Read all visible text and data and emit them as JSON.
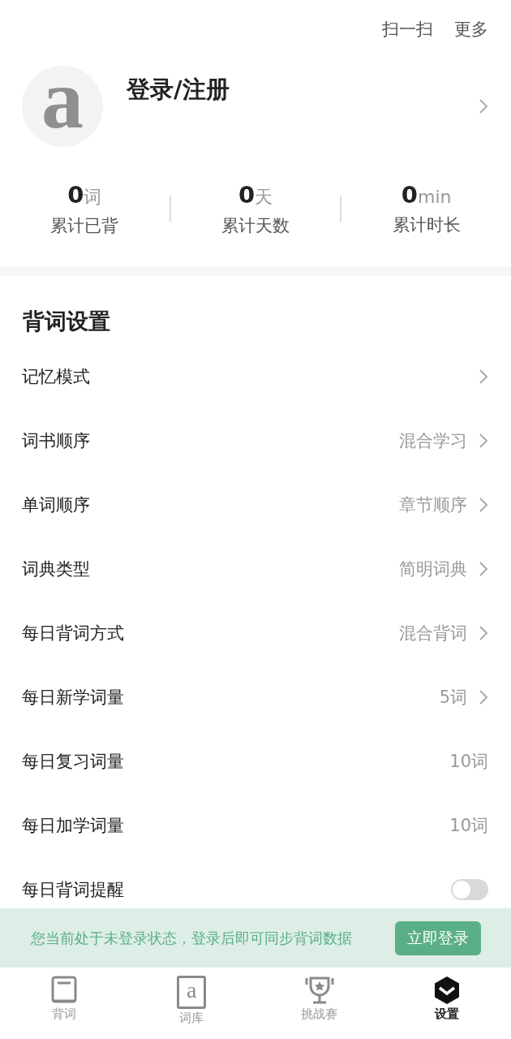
{
  "top_actions": [
    "扫一扫",
    "更多"
  ],
  "profile": {
    "avatar_letter": "a",
    "title": "登录/注册"
  },
  "stats": [
    {
      "value": "0",
      "unit": "词",
      "label": "累计已背"
    },
    {
      "value": "0",
      "unit": "天",
      "label": "累计天数"
    },
    {
      "value": "0",
      "unit": "min",
      "label": "累计时长"
    }
  ],
  "settings": {
    "title": "背词设置",
    "rows": [
      {
        "kind": "link",
        "label": "记忆模式"
      },
      {
        "kind": "link",
        "label": "词书顺序",
        "value": "混合学习"
      },
      {
        "kind": "link",
        "label": "单词顺序",
        "value": "章节顺序"
      },
      {
        "kind": "link",
        "label": "词典类型",
        "value": "简明词典"
      },
      {
        "kind": "link",
        "label": "每日背词方式",
        "value": "混合背词"
      },
      {
        "kind": "link",
        "label": "每日新学词量",
        "value": "5词"
      },
      {
        "kind": "value",
        "label": "每日复习词量",
        "value": "10词"
      },
      {
        "kind": "value",
        "label": "每日加学词量",
        "value": "10词"
      },
      {
        "kind": "toggle",
        "label": "每日背词提醒",
        "on": false
      }
    ]
  },
  "banner": {
    "text": "您当前处于未登录状态，登录后即可同步背词数据",
    "button": "立即登录"
  },
  "tabs": [
    {
      "kind": "book",
      "label": "背词",
      "selected": false
    },
    {
      "kind": "letter",
      "glyph": "a",
      "label": "词库",
      "selected": false
    },
    {
      "kind": "trophy",
      "label": "挑战赛",
      "selected": false
    },
    {
      "kind": "shield",
      "label": "设置",
      "selected": true
    }
  ]
}
